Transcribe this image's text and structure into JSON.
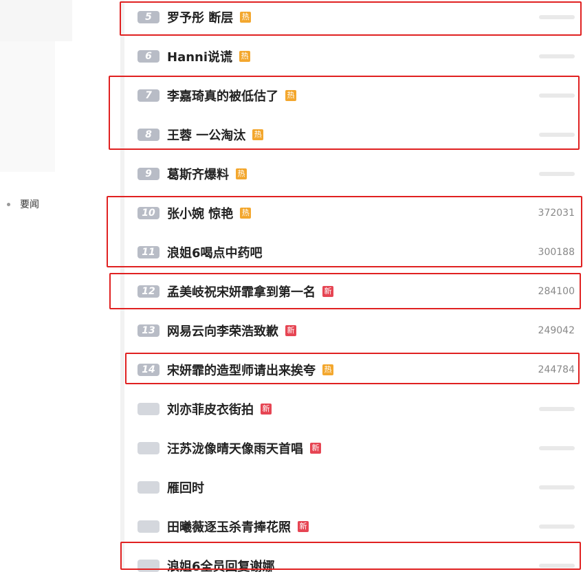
{
  "left_nav": {
    "item": "要闻"
  },
  "tags": {
    "hot": "热",
    "new": "新"
  },
  "colors": {
    "highlight": "#e02020",
    "hot": "#f3a72e",
    "new": "#e64553"
  },
  "rows": [
    {
      "rank": "5",
      "title": "罗予彤 断层",
      "tag": "hot",
      "count": ""
    },
    {
      "rank": "6",
      "title": "Hanni说谎",
      "tag": "hot",
      "count": ""
    },
    {
      "rank": "7",
      "title": "李嘉琦真的被低估了",
      "tag": "hot",
      "count": ""
    },
    {
      "rank": "8",
      "title": "王蓉 一公淘汰",
      "tag": "hot",
      "count": ""
    },
    {
      "rank": "9",
      "title": "葛斯齐爆料",
      "tag": "hot",
      "count": ""
    },
    {
      "rank": "10",
      "title": "张小婉 惊艳",
      "tag": "hot",
      "count": "372031"
    },
    {
      "rank": "11",
      "title": "浪姐6喝点中药吧",
      "tag": "",
      "count": "300188"
    },
    {
      "rank": "12",
      "title": "孟美岐祝宋妍霏拿到第一名",
      "tag": "new",
      "count": "284100"
    },
    {
      "rank": "13",
      "title": "网易云向李荣浩致歉",
      "tag": "new",
      "count": "249042"
    },
    {
      "rank": "14",
      "title": "宋妍霏的造型师请出来挨夸",
      "tag": "hot",
      "count": "244784"
    },
    {
      "rank": "",
      "title": "刘亦菲皮衣街拍",
      "tag": "new",
      "count": ""
    },
    {
      "rank": "",
      "title": "汪苏泷像晴天像雨天首唱",
      "tag": "new",
      "count": ""
    },
    {
      "rank": "",
      "title": "雁回时",
      "tag": "",
      "count": ""
    },
    {
      "rank": "",
      "title": "田曦薇逐玉杀青捧花照",
      "tag": "new",
      "count": ""
    },
    {
      "rank": "",
      "title": "浪姐6全员回复谢娜",
      "tag": "",
      "count": ""
    }
  ]
}
